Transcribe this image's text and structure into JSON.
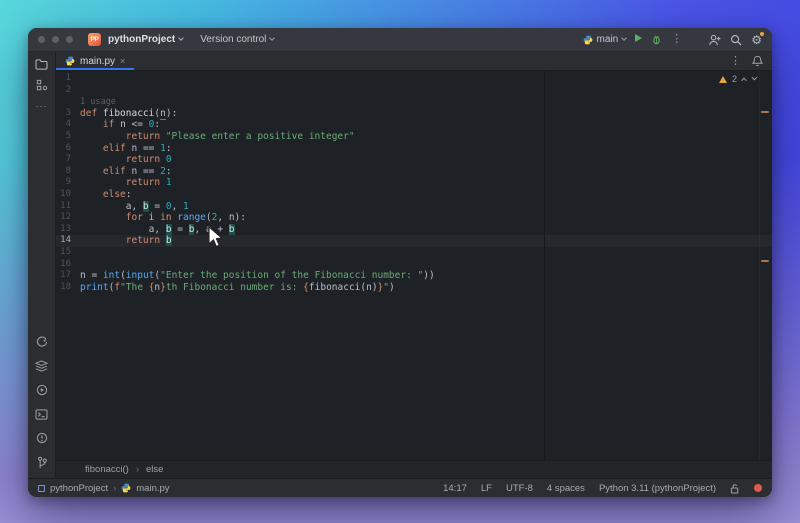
{
  "icons": {
    "kebab": "⋮",
    "close": "×",
    "more": "···",
    "gear": "⚙",
    "sep": "›"
  },
  "titlebar": {
    "logo": "PP",
    "project": "pythonProject",
    "vcs": "Version control",
    "branch": "main"
  },
  "tab": {
    "label": "main.py"
  },
  "editor": {
    "warnings_count": "2",
    "lines": [
      {
        "n": "1",
        "tokens": []
      },
      {
        "n": "2",
        "tokens": []
      },
      {
        "n": "",
        "inlay": "1 usage",
        "tokens": []
      },
      {
        "n": "3",
        "tokens": [
          {
            "t": "def ",
            "c": "kw"
          },
          {
            "t": "fibonacci",
            "c": "fn"
          },
          {
            "t": "(",
            "c": "pl"
          },
          {
            "t": "n",
            "c": "pu"
          },
          {
            "t": "):",
            "c": "pl"
          }
        ]
      },
      {
        "n": "4",
        "tokens": [
          {
            "t": "    ",
            "c": "pl"
          },
          {
            "t": "if",
            "c": "kw"
          },
          {
            "t": " n <= ",
            "c": "pl"
          },
          {
            "t": "0",
            "c": "num"
          },
          {
            "t": ":",
            "c": "pl"
          }
        ]
      },
      {
        "n": "5",
        "tokens": [
          {
            "t": "        ",
            "c": "pl"
          },
          {
            "t": "return",
            "c": "kw"
          },
          {
            "t": " ",
            "c": "pl"
          },
          {
            "t": "\"Please enter a positive integer\"",
            "c": "str"
          }
        ]
      },
      {
        "n": "6",
        "tokens": [
          {
            "t": "    ",
            "c": "pl"
          },
          {
            "t": "elif",
            "c": "kw"
          },
          {
            "t": " n == ",
            "c": "pl"
          },
          {
            "t": "1",
            "c": "num"
          },
          {
            "t": ":",
            "c": "pl"
          }
        ]
      },
      {
        "n": "7",
        "tokens": [
          {
            "t": "        ",
            "c": "pl"
          },
          {
            "t": "return",
            "c": "kw"
          },
          {
            "t": " ",
            "c": "pl"
          },
          {
            "t": "0",
            "c": "num"
          }
        ]
      },
      {
        "n": "8",
        "tokens": [
          {
            "t": "    ",
            "c": "pl"
          },
          {
            "t": "elif",
            "c": "kw"
          },
          {
            "t": " n == ",
            "c": "pl"
          },
          {
            "t": "2",
            "c": "num"
          },
          {
            "t": ":",
            "c": "pl"
          }
        ]
      },
      {
        "n": "9",
        "tokens": [
          {
            "t": "        ",
            "c": "pl"
          },
          {
            "t": "return",
            "c": "kw"
          },
          {
            "t": " ",
            "c": "pl"
          },
          {
            "t": "1",
            "c": "num"
          }
        ]
      },
      {
        "n": "10",
        "tokens": [
          {
            "t": "    ",
            "c": "pl"
          },
          {
            "t": "else",
            "c": "kw"
          },
          {
            "t": ":",
            "c": "pl"
          }
        ]
      },
      {
        "n": "11",
        "tokens": [
          {
            "t": "        a, ",
            "c": "pl"
          },
          {
            "t": "b",
            "c": "hb"
          },
          {
            "t": " = ",
            "c": "pl"
          },
          {
            "t": "0",
            "c": "num"
          },
          {
            "t": ", ",
            "c": "pl"
          },
          {
            "t": "1",
            "c": "num"
          }
        ]
      },
      {
        "n": "12",
        "tokens": [
          {
            "t": "        ",
            "c": "pl"
          },
          {
            "t": "for",
            "c": "kw"
          },
          {
            "t": " i ",
            "c": "pl"
          },
          {
            "t": "in",
            "c": "kw"
          },
          {
            "t": " ",
            "c": "pl"
          },
          {
            "t": "range",
            "c": "bi"
          },
          {
            "t": "(",
            "c": "pl"
          },
          {
            "t": "2",
            "c": "num"
          },
          {
            "t": ", n):",
            "c": "pl"
          }
        ]
      },
      {
        "n": "13",
        "tokens": [
          {
            "t": "            a, ",
            "c": "pl"
          },
          {
            "t": "b",
            "c": "hb"
          },
          {
            "t": " = ",
            "c": "pl"
          },
          {
            "t": "b",
            "c": "hb"
          },
          {
            "t": ", a + ",
            "c": "pl"
          },
          {
            "t": "b",
            "c": "hb"
          }
        ]
      },
      {
        "n": "14",
        "current": true,
        "tokens": [
          {
            "t": "        ",
            "c": "pl"
          },
          {
            "t": "return",
            "c": "kw"
          },
          {
            "t": " ",
            "c": "pl"
          },
          {
            "t": "b",
            "c": "hb"
          }
        ]
      },
      {
        "n": "15",
        "tokens": []
      },
      {
        "n": "16",
        "tokens": []
      },
      {
        "n": "17",
        "tokens": [
          {
            "t": "n = ",
            "c": "pl"
          },
          {
            "t": "int",
            "c": "bi"
          },
          {
            "t": "(",
            "c": "pl"
          },
          {
            "t": "input",
            "c": "bi"
          },
          {
            "t": "(",
            "c": "pl"
          },
          {
            "t": "\"Enter the position of the Fibonacci number: \"",
            "c": "str"
          },
          {
            "t": "))",
            "c": "pl"
          }
        ]
      },
      {
        "n": "18",
        "tokens": [
          {
            "t": "print",
            "c": "bi"
          },
          {
            "t": "(",
            "c": "pl"
          },
          {
            "t": "f",
            "c": "kw"
          },
          {
            "t": "\"The ",
            "c": "str"
          },
          {
            "t": "{",
            "c": "kw"
          },
          {
            "t": "n",
            "c": "pl"
          },
          {
            "t": "}",
            "c": "kw"
          },
          {
            "t": "th Fibonacci number is: ",
            "c": "str"
          },
          {
            "t": "{",
            "c": "kw"
          },
          {
            "t": "fibonacci(n)",
            "c": "pl"
          },
          {
            "t": "}",
            "c": "kw"
          },
          {
            "t": "\"",
            "c": "str"
          },
          {
            "t": ")",
            "c": "pl"
          }
        ]
      }
    ]
  },
  "breadcrumbs": {
    "items": [
      "fibonacci()",
      "else"
    ]
  },
  "statusbar": {
    "project": "pythonProject",
    "file": "main.py",
    "right": [
      "14:17",
      "LF",
      "UTF-8",
      "4 spaces",
      "Python 3.11 (pythonProject)"
    ]
  },
  "colors": {
    "accent_blue": "#3574f0",
    "run_green": "#5fad65",
    "warning_orange": "#e8a33d",
    "keyword": "#cf8e6d",
    "string": "#6aab73",
    "number": "#2aacb8",
    "builtin": "#56a8f5"
  }
}
